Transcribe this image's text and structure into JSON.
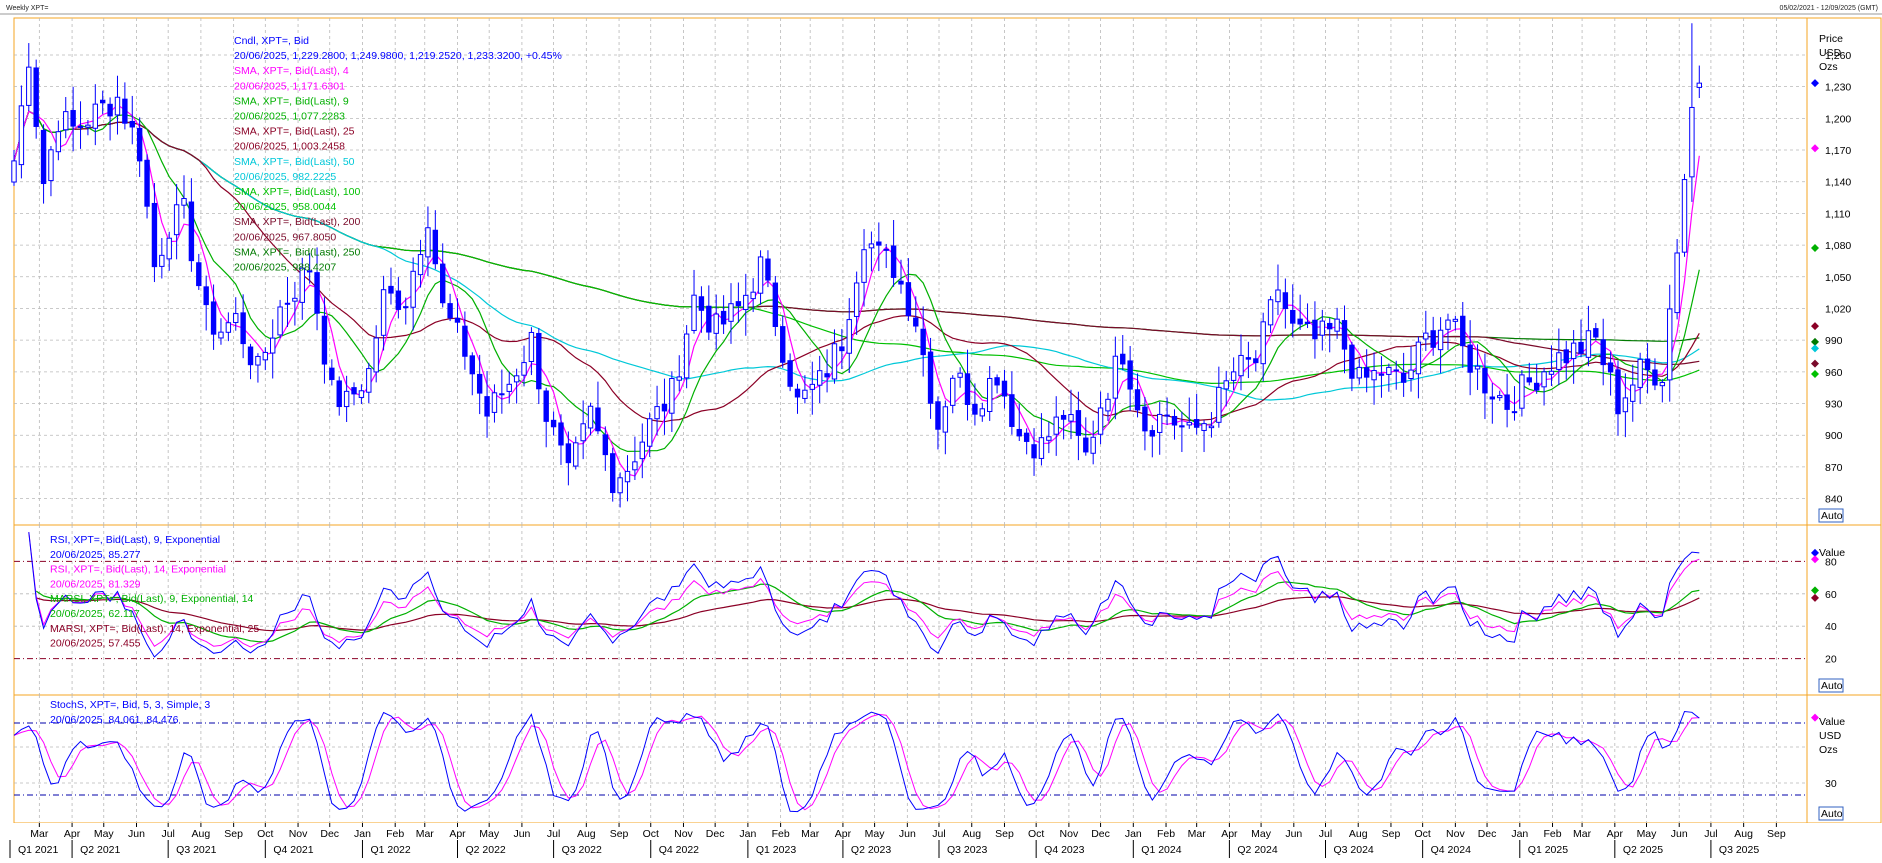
{
  "header": {
    "left": "Weekly XPT=",
    "right": "05/02/2021 - 12/09/2025 (GMT)"
  },
  "colors": {
    "frame": "#f5a623",
    "grid": "#b8b8b8",
    "candle": "#0000ff",
    "sma4": "#ff00ff",
    "sma9": "#00b000",
    "sma25": "#8b0026",
    "sma50": "#00c8d8",
    "sma100": "#00c000",
    "sma200": "#7a0a2a",
    "sma250": "#007a00",
    "rsi_ref": "#8b0026",
    "stoch_ref": "#0000aa"
  },
  "chart_data": [
    {
      "type": "candlestick",
      "name": "main",
      "legend": [
        {
          "text": "Cndl, XPT=, Bid",
          "color": "#0000ff"
        },
        {
          "text": "20/06/2025, 1,229.2800, 1,249.9800, 1,219.2520, 1,233.3200, +0.45%",
          "color": "#0000ff"
        },
        {
          "text": "SMA, XPT=, Bid(Last), 4",
          "color": "#ff00ff"
        },
        {
          "text": "20/06/2025, 1,171.6301",
          "color": "#ff00ff"
        },
        {
          "text": "SMA, XPT=, Bid(Last), 9",
          "color": "#00b000"
        },
        {
          "text": "20/06/2025, 1,077.2283",
          "color": "#00b000"
        },
        {
          "text": "SMA, XPT=, Bid(Last), 25",
          "color": "#8b0026"
        },
        {
          "text": "20/06/2025, 1,003.2458",
          "color": "#8b0026"
        },
        {
          "text": "SMA, XPT=, Bid(Last), 50",
          "color": "#00c8d8"
        },
        {
          "text": "20/06/2025, 982.2225",
          "color": "#00c8d8"
        },
        {
          "text": "SMA, XPT=, Bid(Last), 100",
          "color": "#00c000"
        },
        {
          "text": "20/06/2025, 958.0044",
          "color": "#00c000"
        },
        {
          "text": "SMA, XPT=, Bid(Last), 200",
          "color": "#7a0a2a"
        },
        {
          "text": "20/06/2025, 967.8050",
          "color": "#7a0a2a"
        },
        {
          "text": "SMA, XPT=, Bid(Last), 250",
          "color": "#007a00"
        },
        {
          "text": "20/06/2025, 988.4207",
          "color": "#007a00"
        }
      ],
      "axis_header": [
        "Price",
        "USD",
        "Ozs"
      ],
      "yticks": [
        1260,
        1230,
        1200,
        1170,
        1140,
        1110,
        1080,
        1050,
        1020,
        990,
        960,
        930,
        900,
        870,
        840
      ],
      "ytick_labels": [
        "1,260",
        "1,230",
        "1,200",
        "1,170",
        "1,140",
        "1,110",
        "1,080",
        "1,050",
        "1,020",
        "990",
        "960",
        "930",
        "900",
        "870",
        "840"
      ],
      "ylim": [
        815,
        1295
      ],
      "scale_button": "Auto",
      "markers": [
        {
          "value": 1233.32,
          "color": "#0000ff"
        },
        {
          "value": 1171.63,
          "color": "#ff00ff"
        },
        {
          "value": 1077.23,
          "color": "#00b000"
        },
        {
          "value": 1003.25,
          "color": "#8b0026"
        },
        {
          "value": 988.42,
          "color": "#007a00"
        },
        {
          "value": 982.22,
          "color": "#00c8d8"
        },
        {
          "value": 967.8,
          "color": "#7a0a2a"
        },
        {
          "value": 958.0,
          "color": "#00c000"
        }
      ],
      "close_anchors": [
        [
          "2021-02-05",
          1160
        ],
        [
          "2021-02-19",
          1260
        ],
        [
          "2021-03-05",
          1140
        ],
        [
          "2021-03-19",
          1200
        ],
        [
          "2021-04-02",
          1190
        ],
        [
          "2021-04-16",
          1200
        ],
        [
          "2021-04-30",
          1210
        ],
        [
          "2021-05-14",
          1220
        ],
        [
          "2021-06-04",
          1170
        ],
        [
          "2021-06-18",
          1060
        ],
        [
          "2021-07-02",
          1100
        ],
        [
          "2021-07-16",
          1110
        ],
        [
          "2021-08-06",
          1010
        ],
        [
          "2021-08-20",
          1000
        ],
        [
          "2021-09-03",
          1010
        ],
        [
          "2021-09-24",
          960
        ],
        [
          "2021-10-15",
          1020
        ],
        [
          "2021-10-29",
          1040
        ],
        [
          "2021-11-12",
          1060
        ],
        [
          "2021-12-03",
          940
        ],
        [
          "2021-12-17",
          930
        ],
        [
          "2022-01-07",
          960
        ],
        [
          "2022-01-21",
          1030
        ],
        [
          "2022-02-11",
          1030
        ],
        [
          "2022-03-04",
          1110
        ],
        [
          "2022-03-18",
          1020
        ],
        [
          "2022-04-08",
          980
        ],
        [
          "2022-04-29",
          920
        ],
        [
          "2022-05-20",
          950
        ],
        [
          "2022-06-10",
          990
        ],
        [
          "2022-06-24",
          920
        ],
        [
          "2022-07-15",
          860
        ],
        [
          "2022-08-05",
          920
        ],
        [
          "2022-08-26",
          860
        ],
        [
          "2022-09-09",
          870
        ],
        [
          "2022-09-30",
          910
        ],
        [
          "2022-10-21",
          940
        ],
        [
          "2022-11-11",
          1030
        ],
        [
          "2022-12-02",
          1000
        ],
        [
          "2022-12-23",
          1020
        ],
        [
          "2023-01-13",
          1060
        ],
        [
          "2023-01-27",
          1010
        ],
        [
          "2023-02-17",
          930
        ],
        [
          "2023-03-10",
          950
        ],
        [
          "2023-03-31",
          990
        ],
        [
          "2023-04-21",
          1090
        ],
        [
          "2023-05-05",
          1070
        ],
        [
          "2023-05-19",
          1060
        ],
        [
          "2023-06-09",
          1010
        ],
        [
          "2023-06-30",
          910
        ],
        [
          "2023-07-14",
          960
        ],
        [
          "2023-08-04",
          930
        ],
        [
          "2023-08-25",
          960
        ],
        [
          "2023-09-15",
          900
        ],
        [
          "2023-10-06",
          890
        ],
        [
          "2023-10-27",
          920
        ],
        [
          "2023-11-17",
          880
        ],
        [
          "2023-12-01",
          930
        ],
        [
          "2023-12-22",
          980
        ],
        [
          "2024-01-12",
          910
        ],
        [
          "2024-02-02",
          920
        ],
        [
          "2024-02-23",
          900
        ],
        [
          "2024-03-15",
          920
        ],
        [
          "2024-04-05",
          960
        ],
        [
          "2024-04-26",
          970
        ],
        [
          "2024-05-17",
          1040
        ],
        [
          "2024-05-31",
          1000
        ],
        [
          "2024-06-21",
          990
        ],
        [
          "2024-07-12",
          1000
        ],
        [
          "2024-08-02",
          950
        ],
        [
          "2024-08-23",
          960
        ],
        [
          "2024-09-13",
          950
        ],
        [
          "2024-10-04",
          990
        ],
        [
          "2024-10-25",
          1010
        ],
        [
          "2024-11-08",
          980
        ],
        [
          "2024-11-29",
          950
        ],
        [
          "2024-12-20",
          930
        ],
        [
          "2025-01-10",
          950
        ],
        [
          "2025-01-31",
          970
        ],
        [
          "2025-02-21",
          980
        ],
        [
          "2025-03-14",
          990
        ],
        [
          "2025-04-04",
          930
        ],
        [
          "2025-04-25",
          960
        ],
        [
          "2025-05-16",
          960
        ],
        [
          "2025-05-30",
          1080
        ],
        [
          "2025-06-13",
          1210
        ],
        [
          "2025-06-20",
          1233.32
        ]
      ]
    },
    {
      "type": "line",
      "name": "rsi",
      "legend": [
        {
          "text": "RSI, XPT=, Bid(Last), 9, Exponential",
          "color": "#0000ff"
        },
        {
          "text": "20/06/2025, 85.277",
          "color": "#0000ff"
        },
        {
          "text": "RSI, XPT=, Bid(Last), 14, Exponential",
          "color": "#ff00ff"
        },
        {
          "text": "20/06/2025, 81.329",
          "color": "#ff00ff"
        },
        {
          "text": "MARSI, XPT=, Bid(Last), 9, Exponential, 14",
          "color": "#00b000"
        },
        {
          "text": "20/06/2025, 62.117",
          "color": "#00b000"
        },
        {
          "text": "MARSI, XPT=, Bid(Last), 14, Exponential, 25",
          "color": "#8b0026"
        },
        {
          "text": "20/06/2025, 57.455",
          "color": "#8b0026"
        }
      ],
      "axis_header": [
        "Value"
      ],
      "yticks": [
        80,
        60,
        40,
        20
      ],
      "ytick_labels": [
        "80",
        "60",
        "40",
        "20"
      ],
      "ylim": [
        0,
        100
      ],
      "reference_lines": [
        80,
        20
      ],
      "scale_button": "Auto",
      "markers": [
        {
          "value": 85.28,
          "color": "#0000ff"
        },
        {
          "value": 81.33,
          "color": "#ff00ff"
        },
        {
          "value": 62.12,
          "color": "#00b000"
        },
        {
          "value": 57.46,
          "color": "#8b0026"
        }
      ]
    },
    {
      "type": "line",
      "name": "stochastic",
      "legend": [
        {
          "text": "StochS, XPT=, Bid, 5, 3, Simple, 3",
          "color": "#0000ff"
        },
        {
          "text": "20/06/2025, 84.061, 84.476",
          "color": "#0000ff"
        }
      ],
      "axis_header": [
        "Value",
        "USD",
        "Ozs"
      ],
      "yticks": [
        30
      ],
      "ytick_labels": [
        "30"
      ],
      "ylim": [
        0,
        100
      ],
      "reference_lines": [
        80,
        20
      ],
      "scale_button": "Auto",
      "markers": [
        {
          "value": 84.48,
          "color": "#ff00ff"
        }
      ]
    }
  ],
  "x_axis": {
    "start": "2021-02-05",
    "end": "2025-09-30",
    "months": [
      {
        "label": "Mar",
        "date": "2021-03-01"
      },
      {
        "label": "Apr",
        "date": "2021-04-01"
      },
      {
        "label": "May",
        "date": "2021-05-01"
      },
      {
        "label": "Jun",
        "date": "2021-06-01"
      },
      {
        "label": "Jul",
        "date": "2021-07-01"
      },
      {
        "label": "Aug",
        "date": "2021-08-01"
      },
      {
        "label": "Sep",
        "date": "2021-09-01"
      },
      {
        "label": "Oct",
        "date": "2021-10-01"
      },
      {
        "label": "Nov",
        "date": "2021-11-01"
      },
      {
        "label": "Dec",
        "date": "2021-12-01"
      },
      {
        "label": "Jan",
        "date": "2022-01-01"
      },
      {
        "label": "Feb",
        "date": "2022-02-01"
      },
      {
        "label": "Mar",
        "date": "2022-03-01"
      },
      {
        "label": "Apr",
        "date": "2022-04-01"
      },
      {
        "label": "May",
        "date": "2022-05-01"
      },
      {
        "label": "Jun",
        "date": "2022-06-01"
      },
      {
        "label": "Jul",
        "date": "2022-07-01"
      },
      {
        "label": "Aug",
        "date": "2022-08-01"
      },
      {
        "label": "Sep",
        "date": "2022-09-01"
      },
      {
        "label": "Oct",
        "date": "2022-10-01"
      },
      {
        "label": "Nov",
        "date": "2022-11-01"
      },
      {
        "label": "Dec",
        "date": "2022-12-01"
      },
      {
        "label": "Jan",
        "date": "2023-01-01"
      },
      {
        "label": "Feb",
        "date": "2023-02-01"
      },
      {
        "label": "Mar",
        "date": "2023-03-01"
      },
      {
        "label": "Apr",
        "date": "2023-04-01"
      },
      {
        "label": "May",
        "date": "2023-05-01"
      },
      {
        "label": "Jun",
        "date": "2023-06-01"
      },
      {
        "label": "Jul",
        "date": "2023-07-01"
      },
      {
        "label": "Aug",
        "date": "2023-08-01"
      },
      {
        "label": "Sep",
        "date": "2023-09-01"
      },
      {
        "label": "Oct",
        "date": "2023-10-01"
      },
      {
        "label": "Nov",
        "date": "2023-11-01"
      },
      {
        "label": "Dec",
        "date": "2023-12-01"
      },
      {
        "label": "Jan",
        "date": "2024-01-01"
      },
      {
        "label": "Feb",
        "date": "2024-02-01"
      },
      {
        "label": "Mar",
        "date": "2024-03-01"
      },
      {
        "label": "Apr",
        "date": "2024-04-01"
      },
      {
        "label": "May",
        "date": "2024-05-01"
      },
      {
        "label": "Jun",
        "date": "2024-06-01"
      },
      {
        "label": "Jul",
        "date": "2024-07-01"
      },
      {
        "label": "Aug",
        "date": "2024-08-01"
      },
      {
        "label": "Sep",
        "date": "2024-09-01"
      },
      {
        "label": "Oct",
        "date": "2024-10-01"
      },
      {
        "label": "Nov",
        "date": "2024-11-01"
      },
      {
        "label": "Dec",
        "date": "2024-12-01"
      },
      {
        "label": "Jan",
        "date": "2025-01-01"
      },
      {
        "label": "Feb",
        "date": "2025-02-01"
      },
      {
        "label": "Mar",
        "date": "2025-03-01"
      },
      {
        "label": "Apr",
        "date": "2025-04-01"
      },
      {
        "label": "May",
        "date": "2025-05-01"
      },
      {
        "label": "Jun",
        "date": "2025-06-01"
      },
      {
        "label": "Jul",
        "date": "2025-07-01"
      },
      {
        "label": "Aug",
        "date": "2025-08-01"
      },
      {
        "label": "Sep",
        "date": "2025-09-01"
      }
    ],
    "quarters": [
      {
        "label": "Q1 2021",
        "date": "2021-01-01"
      },
      {
        "label": "Q2 2021",
        "date": "2021-04-01"
      },
      {
        "label": "Q3 2021",
        "date": "2021-07-01"
      },
      {
        "label": "Q4 2021",
        "date": "2021-10-01"
      },
      {
        "label": "Q1 2022",
        "date": "2022-01-01"
      },
      {
        "label": "Q2 2022",
        "date": "2022-04-01"
      },
      {
        "label": "Q3 2022",
        "date": "2022-07-01"
      },
      {
        "label": "Q4 2022",
        "date": "2022-10-01"
      },
      {
        "label": "Q1 2023",
        "date": "2023-01-01"
      },
      {
        "label": "Q2 2023",
        "date": "2023-04-01"
      },
      {
        "label": "Q3 2023",
        "date": "2023-07-01"
      },
      {
        "label": "Q4 2023",
        "date": "2023-10-01"
      },
      {
        "label": "Q1 2024",
        "date": "2024-01-01"
      },
      {
        "label": "Q2 2024",
        "date": "2024-04-01"
      },
      {
        "label": "Q3 2024",
        "date": "2024-07-01"
      },
      {
        "label": "Q4 2024",
        "date": "2024-10-01"
      },
      {
        "label": "Q1 2025",
        "date": "2025-01-01"
      },
      {
        "label": "Q2 2025",
        "date": "2025-04-01"
      },
      {
        "label": "Q3 2025",
        "date": "2025-07-01"
      }
    ]
  }
}
